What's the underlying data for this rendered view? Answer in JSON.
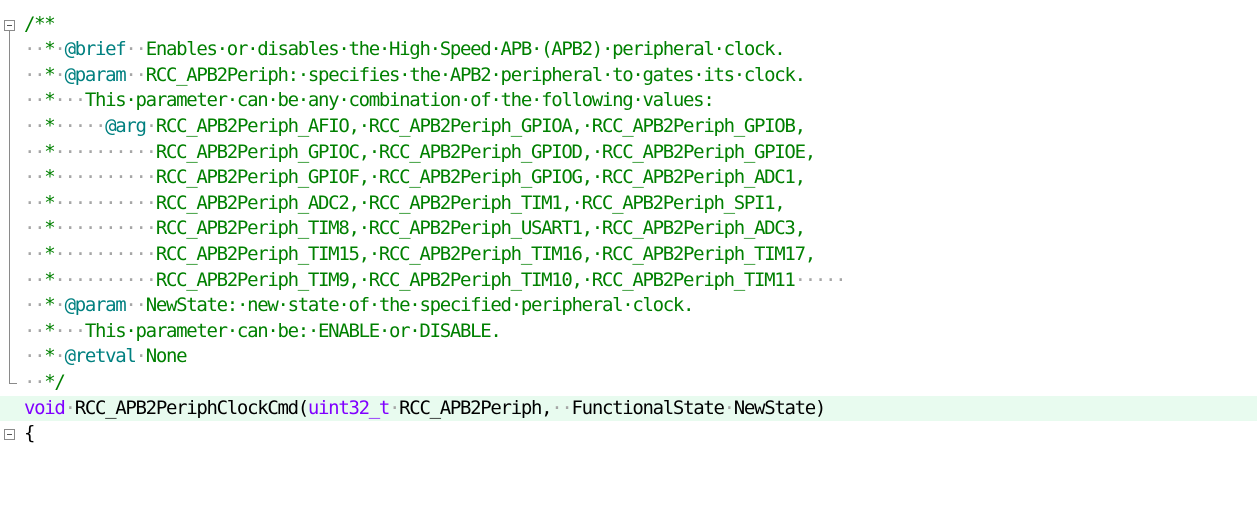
{
  "editor": {
    "lines": [
      {
        "kind": "top-stub"
      },
      {
        "fold": "open",
        "segments": [
          {
            "t": "/**",
            "c": "comment"
          }
        ]
      },
      {
        "fold": "body",
        "segments": [
          {
            "t": "··",
            "c": "ws"
          },
          {
            "t": "*",
            "c": "comment"
          },
          {
            "t": "·",
            "c": "ws"
          },
          {
            "t": "@brief",
            "c": "doctag"
          },
          {
            "t": "··",
            "c": "ws"
          },
          {
            "t": "Enables·or·disables·the·High·Speed·APB·(APB2)·peripheral·clock.",
            "c": "comment"
          }
        ]
      },
      {
        "fold": "body",
        "segments": [
          {
            "t": "··",
            "c": "ws"
          },
          {
            "t": "*",
            "c": "comment"
          },
          {
            "t": "·",
            "c": "ws"
          },
          {
            "t": "@param",
            "c": "doctag"
          },
          {
            "t": "··",
            "c": "ws"
          },
          {
            "t": "RCC_APB2Periph:·specifies·the·APB2·peripheral·to·gates·its·clock.",
            "c": "comment"
          }
        ]
      },
      {
        "fold": "body",
        "segments": [
          {
            "t": "··",
            "c": "ws"
          },
          {
            "t": "*",
            "c": "comment"
          },
          {
            "t": "···",
            "c": "ws"
          },
          {
            "t": "This·parameter·can·be·any·combination·of·the·following·values:",
            "c": "comment"
          }
        ]
      },
      {
        "fold": "body",
        "segments": [
          {
            "t": "··",
            "c": "ws"
          },
          {
            "t": "*",
            "c": "comment"
          },
          {
            "t": "·····",
            "c": "ws"
          },
          {
            "t": "@arg",
            "c": "doctag"
          },
          {
            "t": "·",
            "c": "ws"
          },
          {
            "t": "RCC_APB2Periph_AFIO,·RCC_APB2Periph_GPIOA,·RCC_APB2Periph_GPIOB,",
            "c": "comment"
          }
        ]
      },
      {
        "fold": "body",
        "segments": [
          {
            "t": "··",
            "c": "ws"
          },
          {
            "t": "*",
            "c": "comment"
          },
          {
            "t": "··········",
            "c": "ws"
          },
          {
            "t": "RCC_APB2Periph_GPIOC,·RCC_APB2Periph_GPIOD,·RCC_APB2Periph_GPIOE,",
            "c": "comment"
          }
        ]
      },
      {
        "fold": "body",
        "segments": [
          {
            "t": "··",
            "c": "ws"
          },
          {
            "t": "*",
            "c": "comment"
          },
          {
            "t": "··········",
            "c": "ws"
          },
          {
            "t": "RCC_APB2Periph_GPIOF,·RCC_APB2Periph_GPIOG,·RCC_APB2Periph_ADC1,",
            "c": "comment"
          }
        ]
      },
      {
        "fold": "body",
        "segments": [
          {
            "t": "··",
            "c": "ws"
          },
          {
            "t": "*",
            "c": "comment"
          },
          {
            "t": "··········",
            "c": "ws"
          },
          {
            "t": "RCC_APB2Periph_ADC2,·RCC_APB2Periph_TIM1,·RCC_APB2Periph_SPI1,",
            "c": "comment"
          }
        ]
      },
      {
        "fold": "body",
        "segments": [
          {
            "t": "··",
            "c": "ws"
          },
          {
            "t": "*",
            "c": "comment"
          },
          {
            "t": "··········",
            "c": "ws"
          },
          {
            "t": "RCC_APB2Periph_TIM8,·RCC_APB2Periph_USART1,·RCC_APB2Periph_ADC3,",
            "c": "comment"
          }
        ]
      },
      {
        "fold": "body",
        "segments": [
          {
            "t": "··",
            "c": "ws"
          },
          {
            "t": "*",
            "c": "comment"
          },
          {
            "t": "··········",
            "c": "ws"
          },
          {
            "t": "RCC_APB2Periph_TIM15,·RCC_APB2Periph_TIM16,·RCC_APB2Periph_TIM17,",
            "c": "comment"
          }
        ]
      },
      {
        "fold": "body",
        "segments": [
          {
            "t": "··",
            "c": "ws"
          },
          {
            "t": "*",
            "c": "comment"
          },
          {
            "t": "··········",
            "c": "ws"
          },
          {
            "t": "RCC_APB2Periph_TIM9,·RCC_APB2Periph_TIM10,·RCC_APB2Periph_TIM11",
            "c": "comment"
          },
          {
            "t": "·····",
            "c": "ws"
          }
        ]
      },
      {
        "fold": "body",
        "segments": [
          {
            "t": "··",
            "c": "ws"
          },
          {
            "t": "*",
            "c": "comment"
          },
          {
            "t": "·",
            "c": "ws"
          },
          {
            "t": "@param",
            "c": "doctag"
          },
          {
            "t": "··",
            "c": "ws"
          },
          {
            "t": "NewState:·new·state·of·the·specified·peripheral·clock.",
            "c": "comment"
          }
        ]
      },
      {
        "fold": "body",
        "segments": [
          {
            "t": "··",
            "c": "ws"
          },
          {
            "t": "*",
            "c": "comment"
          },
          {
            "t": "···",
            "c": "ws"
          },
          {
            "t": "This·parameter·can·be:·ENABLE·or·DISABLE.",
            "c": "comment"
          }
        ]
      },
      {
        "fold": "body",
        "segments": [
          {
            "t": "··",
            "c": "ws"
          },
          {
            "t": "*",
            "c": "comment"
          },
          {
            "t": "·",
            "c": "ws"
          },
          {
            "t": "@retval",
            "c": "doctag"
          },
          {
            "t": "·",
            "c": "ws"
          },
          {
            "t": "None",
            "c": "comment"
          }
        ]
      },
      {
        "fold": "end",
        "segments": [
          {
            "t": "··",
            "c": "ws"
          },
          {
            "t": "*/",
            "c": "comment"
          }
        ]
      },
      {
        "fold": "none",
        "current": true,
        "segments": [
          {
            "t": "void",
            "c": "kw"
          },
          {
            "t": "·",
            "c": "ws"
          },
          {
            "t": "RCC_APB2PeriphClockCmd(",
            "c": "ident"
          },
          {
            "t": "uint32_t",
            "c": "type"
          },
          {
            "t": "·",
            "c": "ws"
          },
          {
            "t": "RCC_APB2Periph,",
            "c": "ident"
          },
          {
            "t": "··",
            "c": "ws"
          },
          {
            "t": "FunctionalState",
            "c": "ident"
          },
          {
            "t": "·",
            "c": "ws"
          },
          {
            "t": "NewState)",
            "c": "ident"
          }
        ]
      },
      {
        "fold": "open",
        "segments": [
          {
            "t": "{",
            "c": "punct"
          }
        ]
      }
    ]
  },
  "colors": {
    "comment": "#008000",
    "doctag": "#008080",
    "keyword": "#8000ff",
    "whitespace_marker": "#a6a6a6",
    "current_line_bg": "#e8fbef"
  }
}
